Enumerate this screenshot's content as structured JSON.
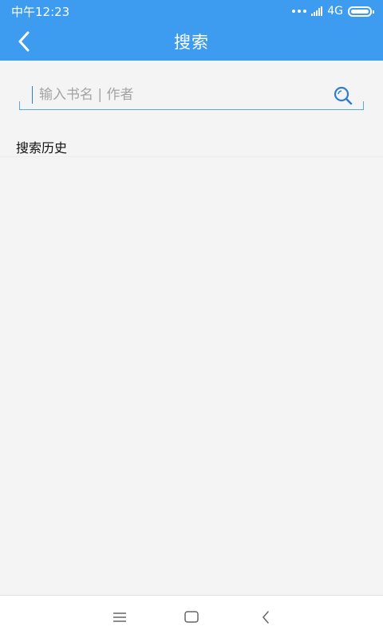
{
  "status": {
    "time": "中午12:23",
    "network": "4G"
  },
  "header": {
    "title": "搜索"
  },
  "search": {
    "placeholder": "输入书名 | 作者",
    "value": ""
  },
  "history": {
    "title": "搜索历史",
    "items": []
  },
  "colors": {
    "accent": "#3d9cf0",
    "background": "#f4f4f4",
    "search_line": "#5aa7e8"
  },
  "icons": {
    "back": "back-arrow-icon",
    "search": "search-icon",
    "nav_menu": "menu-icon",
    "nav_home": "home-icon",
    "nav_back": "back-icon"
  }
}
